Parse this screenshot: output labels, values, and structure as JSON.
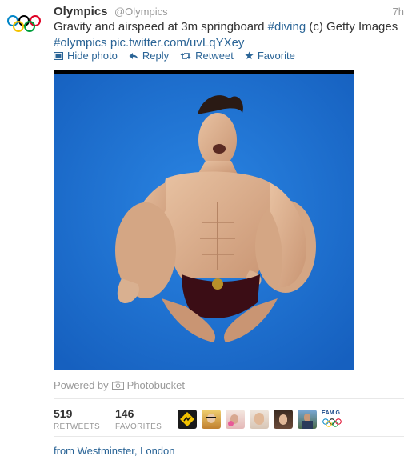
{
  "tweet": {
    "name": "Olympics",
    "handle": "@Olympics",
    "time": "7h",
    "text_plain": "Gravity and airspeed at 3m springboard ",
    "hashtag_diving": "#diving",
    "text_after": " (c) Getty Images",
    "hashtag_olympics": "#olympics",
    "pic_link": "pic.twitter.com/uvLqYXey"
  },
  "actions": {
    "hide_photo": "Hide photo",
    "reply": "Reply",
    "retweet": "Retweet",
    "favorite": "Favorite"
  },
  "media": {
    "powered_by": "Powered by",
    "provider": "Photobucket"
  },
  "stats": {
    "retweets_count": "519",
    "retweets_label": "RETWEETS",
    "favorites_count": "146",
    "favorites_label": "FAVORITES"
  },
  "favoriters": {
    "team_label": "EAM G"
  },
  "location": "from Westminster, London",
  "colors": {
    "link": "#2a6496",
    "pool_blue": "#1f73d0",
    "muted": "#999999"
  }
}
